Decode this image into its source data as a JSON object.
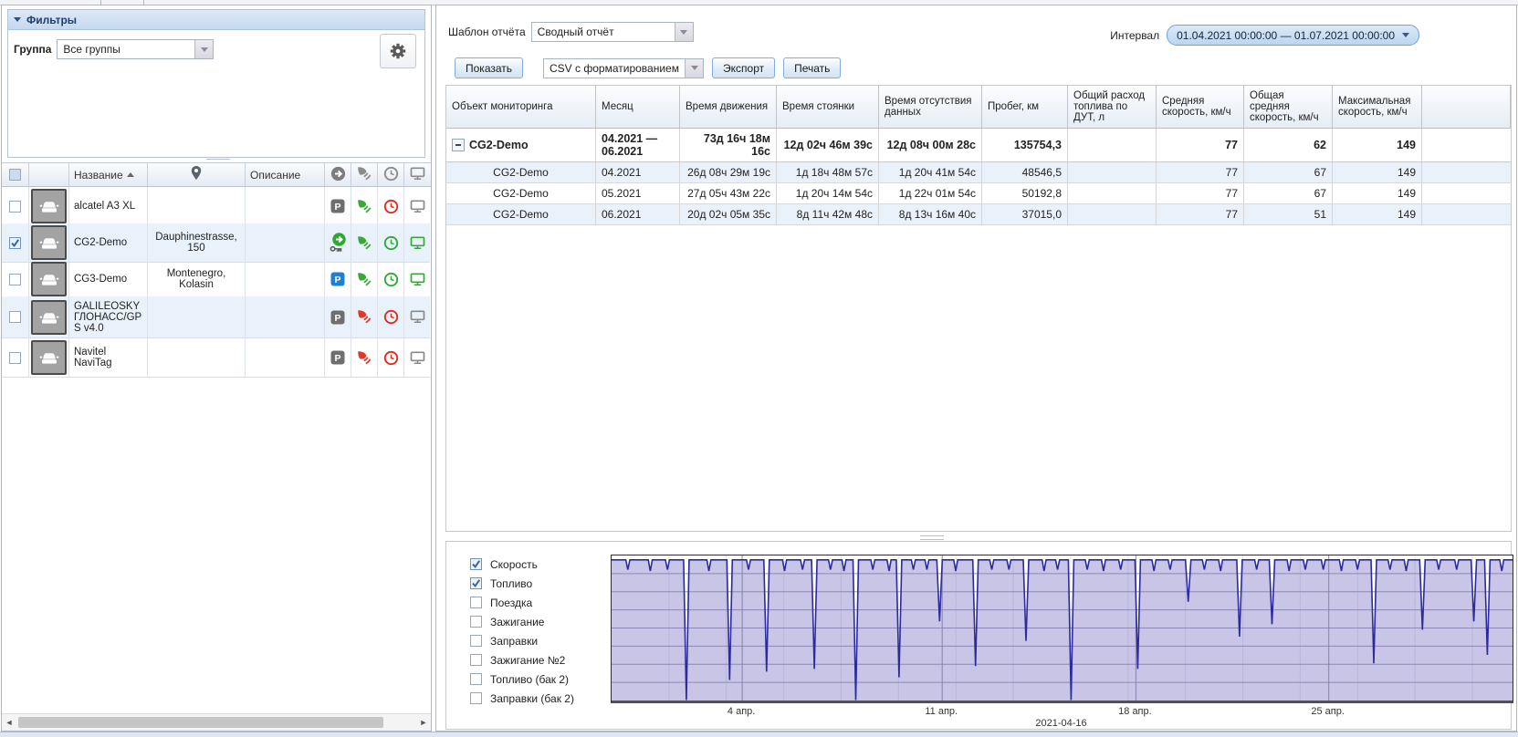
{
  "left_panel": {
    "filters": {
      "title": "Фильтры",
      "group_label": "Группа",
      "group_value": "Все группы"
    },
    "units_table": {
      "header": {
        "name": "Название",
        "description": "Описание",
        "sort": "asc"
      },
      "rows": [
        {
          "name": "alcatel A3 XL",
          "location": "",
          "description": "",
          "checked": false,
          "motion": "parked-gray",
          "signal": "green",
          "clock": "red",
          "monitor": "gray"
        },
        {
          "name": "CG2-Demo",
          "location": "Dauphinestrasse, 150",
          "description": "",
          "checked": true,
          "motion": "moving-key",
          "signal": "green",
          "clock": "green",
          "monitor": "green"
        },
        {
          "name": "CG3-Demo",
          "location": "Montenegro, Kolasin",
          "description": "",
          "checked": false,
          "motion": "parked-blue",
          "signal": "green",
          "clock": "green",
          "monitor": "green"
        },
        {
          "name": "GALILEOSKY ГЛОНАСС/GPS v4.0",
          "location": "",
          "description": "",
          "checked": false,
          "motion": "parked-gray",
          "signal": "red",
          "clock": "red",
          "monitor": "gray"
        },
        {
          "name": "Navitel NaviTag",
          "location": "",
          "description": "",
          "checked": false,
          "motion": "parked-gray",
          "signal": "red",
          "clock": "red",
          "monitor": "gray"
        }
      ]
    }
  },
  "report_panel": {
    "template_label": "Шаблон отчёта",
    "template_value": "Сводный отчёт",
    "interval_label": "Интервал",
    "interval_value": "01.04.2021 00:00:00 — 01.07.2021 00:00:00",
    "show_button": "Показать",
    "export_format_value": "CSV с форматированием",
    "export_button": "Экспорт",
    "print_button": "Печать",
    "table": {
      "headers": [
        "Объект мониторинга",
        "Месяц",
        "Время движения",
        "Время стоянки",
        "Время отсутствия данных",
        "Пробег, км",
        "Общий расход топлива по ДУТ, л",
        "Средняя скорость, км/ч",
        "Общая средняя скорость, км/ч",
        "Максимальная скорость, км/ч"
      ],
      "total_row": {
        "object": "CG2-Demo",
        "month": "04.2021 — 06.2021",
        "values": [
          "73д 16ч 18м 16с",
          "12д 02ч 46м 39с",
          "12д 08ч 00м 28с",
          "135754,3",
          "",
          "77",
          "62",
          "149"
        ]
      },
      "rows": [
        {
          "object": "CG2-Demo",
          "month": "04.2021",
          "values": [
            "26д 08ч 29м 19с",
            "1д 18ч 48м 57с",
            "1д 20ч 41м 54с",
            "48546,5",
            "",
            "77",
            "67",
            "149"
          ]
        },
        {
          "object": "CG2-Demo",
          "month": "05.2021",
          "values": [
            "27д 05ч 43м 22с",
            "1д 20ч 14м 54с",
            "1д 22ч 01м 54с",
            "50192,8",
            "",
            "77",
            "67",
            "149"
          ]
        },
        {
          "object": "CG2-Demo",
          "month": "06.2021",
          "values": [
            "20д 02ч 05м 35с",
            "8д 11ч 42м 48с",
            "8д 13ч 16м 40с",
            "37015,0",
            "",
            "77",
            "51",
            "149"
          ]
        }
      ]
    }
  },
  "chart_panel": {
    "legend": [
      {
        "label": "Скорость",
        "checked": true
      },
      {
        "label": "Топливо",
        "checked": true
      },
      {
        "label": "Поездка",
        "checked": false
      },
      {
        "label": "Зажигание",
        "checked": false
      },
      {
        "label": "Заправки",
        "checked": false
      },
      {
        "label": "Зажигание №2",
        "checked": false
      },
      {
        "label": "Топливо (бак 2)",
        "checked": false
      },
      {
        "label": "Заправки (бак 2)",
        "checked": false
      }
    ]
  },
  "chart_data": {
    "type": "area",
    "title": "",
    "xlabel_note": "2021-04-16",
    "x_ticks": [
      {
        "label": "4 апр.",
        "pos": 0.145
      },
      {
        "label": "11 апр.",
        "pos": 0.367
      },
      {
        "label": "18 апр.",
        "pos": 0.582
      },
      {
        "label": "25 апр.",
        "pos": 0.796
      }
    ],
    "x_range_days": 31.4,
    "baseline": 0.97,
    "colors": {
      "fill": "rgba(125,117,197,0.42)",
      "line": "#2c2a9d",
      "grid": "#9898a8",
      "day_grid": "#8f8aa8",
      "week_grid": "#85859a"
    },
    "grid": {
      "h_lines": 7,
      "day_line_step": 2
    },
    "spikes": [
      {
        "x": 0.018,
        "d": 0.07
      },
      {
        "x": 0.043,
        "d": 0.08
      },
      {
        "x": 0.062,
        "d": 0.07
      },
      {
        "x": 0.083,
        "d": 1.0
      },
      {
        "x": 0.108,
        "d": 0.08
      },
      {
        "x": 0.131,
        "d": 0.86
      },
      {
        "x": 0.152,
        "d": 0.07
      },
      {
        "x": 0.172,
        "d": 0.8
      },
      {
        "x": 0.192,
        "d": 0.08
      },
      {
        "x": 0.212,
        "d": 0.07
      },
      {
        "x": 0.225,
        "d": 0.78
      },
      {
        "x": 0.243,
        "d": 0.07
      },
      {
        "x": 0.258,
        "d": 0.08
      },
      {
        "x": 0.271,
        "d": 1.0
      },
      {
        "x": 0.29,
        "d": 0.07
      },
      {
        "x": 0.308,
        "d": 0.08
      },
      {
        "x": 0.319,
        "d": 0.84
      },
      {
        "x": 0.335,
        "d": 0.07
      },
      {
        "x": 0.35,
        "d": 0.07
      },
      {
        "x": 0.364,
        "d": 0.44
      },
      {
        "x": 0.382,
        "d": 0.08
      },
      {
        "x": 0.404,
        "d": 0.76
      },
      {
        "x": 0.422,
        "d": 0.07
      },
      {
        "x": 0.441,
        "d": 0.07
      },
      {
        "x": 0.46,
        "d": 0.58
      },
      {
        "x": 0.48,
        "d": 0.08
      },
      {
        "x": 0.495,
        "d": 0.07
      },
      {
        "x": 0.51,
        "d": 1.0
      },
      {
        "x": 0.528,
        "d": 0.07
      },
      {
        "x": 0.546,
        "d": 0.08
      },
      {
        "x": 0.565,
        "d": 0.07
      },
      {
        "x": 0.584,
        "d": 0.78
      },
      {
        "x": 0.602,
        "d": 0.08
      },
      {
        "x": 0.62,
        "d": 0.07
      },
      {
        "x": 0.64,
        "d": 0.3
      },
      {
        "x": 0.658,
        "d": 0.07
      },
      {
        "x": 0.676,
        "d": 0.08
      },
      {
        "x": 0.697,
        "d": 0.55
      },
      {
        "x": 0.716,
        "d": 0.07
      },
      {
        "x": 0.733,
        "d": 0.46
      },
      {
        "x": 0.752,
        "d": 0.08
      },
      {
        "x": 0.77,
        "d": 0.07
      },
      {
        "x": 0.79,
        "d": 0.07
      },
      {
        "x": 0.81,
        "d": 0.08
      },
      {
        "x": 0.828,
        "d": 0.07
      },
      {
        "x": 0.846,
        "d": 0.74
      },
      {
        "x": 0.864,
        "d": 0.07
      },
      {
        "x": 0.882,
        "d": 0.08
      },
      {
        "x": 0.9,
        "d": 0.5
      },
      {
        "x": 0.918,
        "d": 0.07
      },
      {
        "x": 0.938,
        "d": 0.07
      },
      {
        "x": 0.957,
        "d": 0.44
      },
      {
        "x": 0.972,
        "d": 0.68
      },
      {
        "x": 0.988,
        "d": 0.08
      }
    ]
  }
}
